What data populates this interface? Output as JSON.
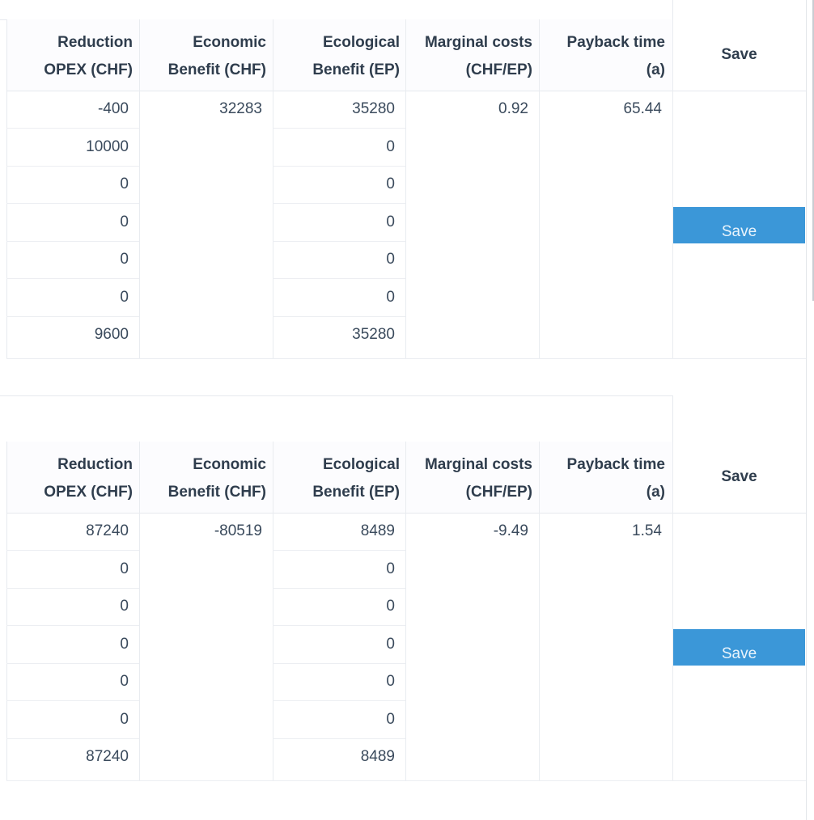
{
  "headers": [
    {
      "line1": "Reduction",
      "line2": "OPEX (CHF)"
    },
    {
      "line1": "Economic",
      "line2": "Benefit (CHF)"
    },
    {
      "line1": "Ecological",
      "line2": "Benefit (EP)"
    },
    {
      "line1": "Marginal costs",
      "line2": "(CHF/EP)"
    },
    {
      "line1": "Payback time",
      "line2": "(a)"
    }
  ],
  "save_header": "Save",
  "tables": [
    {
      "reduction_opex": [
        "-400",
        "10000",
        "0",
        "0",
        "0",
        "0",
        "9600"
      ],
      "economic_benefit": "32283",
      "ecological_benefit": [
        "35280",
        "0",
        "0",
        "0",
        "0",
        "0",
        "35280"
      ],
      "marginal_costs": "0.92",
      "payback_time": "65.44",
      "save_label": "Save"
    },
    {
      "reduction_opex": [
        "87240",
        "0",
        "0",
        "0",
        "0",
        "0",
        "87240"
      ],
      "economic_benefit": "-80519",
      "ecological_benefit": [
        "8489",
        "0",
        "0",
        "0",
        "0",
        "0",
        "8489"
      ],
      "marginal_costs": "-9.49",
      "payback_time": "1.54",
      "save_label": "Save"
    }
  ]
}
